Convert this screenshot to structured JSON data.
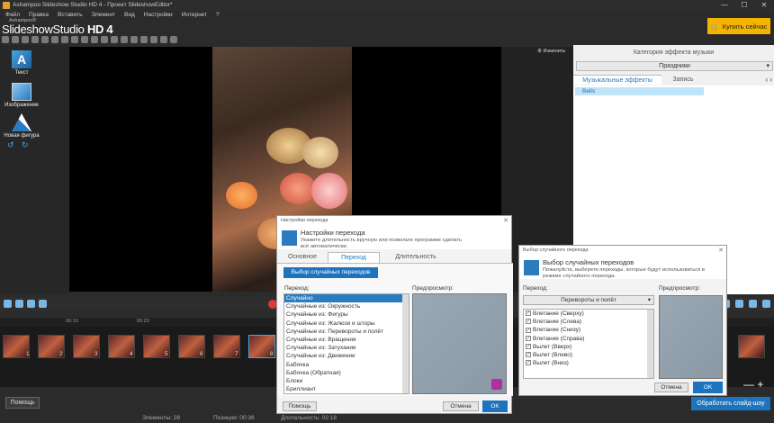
{
  "window": {
    "title": "Ashampoo Slideshow Studio HD 4 - Проект SlideshowEditor*",
    "controls": [
      "—",
      "☐",
      "✕"
    ]
  },
  "menu": [
    "Файл",
    "Правка",
    "Вставить",
    "Элемент",
    "Вид",
    "Настройки",
    "Интернет",
    "?"
  ],
  "buy_button": "Купить сейчас",
  "logo": {
    "small": "Ashampoo®",
    "main": "SlideshowStudio",
    "version": "HD 4"
  },
  "left_panel": {
    "text_label": "Текст",
    "image_label": "Изображение",
    "shape_label": "Новая фигура"
  },
  "preview": {
    "change_label": "Изменить"
  },
  "right_panel": {
    "title": "Категория эффекта музыки",
    "category": "Праздники",
    "tabs": [
      "Музыкальные эффекты",
      "Запись"
    ],
    "items": [
      "Bells"
    ]
  },
  "timeline": {
    "ruler": [
      "00:10",
      "00:20"
    ],
    "clip_numbers": [
      "1",
      "2",
      "3",
      "4",
      "5",
      "6",
      "7",
      "8"
    ],
    "zoom": "— +"
  },
  "bottom": {
    "help": "Помощь",
    "export": "Обработать слайд-шоу"
  },
  "status": {
    "elements": "Элементы: 28",
    "position": "Позиция: 00:36",
    "duration": "Длительность: 02:18"
  },
  "transition_dialog": {
    "window_title": "Настройки перехода",
    "header_title": "Настройки перехода",
    "header_desc": "Укажите длительность вручную или позвольте программе сделать всё автоматически.",
    "tabs": [
      "Основное",
      "Переход",
      "Длительность"
    ],
    "random_button": "Выбор случайных переходов",
    "transition_label": "Переход:",
    "preview_label": "Предпросмотр:",
    "items": [
      "Случайно",
      "Случайные из: Окружность",
      "Случайные из: Фигуры",
      "Случайные из: Жалюзи и шторы",
      "Случайные из: Перевороты и полёт",
      "Случайные из: Вращения",
      "Случайные из: Затухание",
      "Случайные из: Движение",
      "Бабочка",
      "Бабочка (Обратная)",
      "Блоки",
      "Бриллиант"
    ],
    "help": "Помощь",
    "cancel": "Отмена",
    "ok": "OK"
  },
  "random_dialog": {
    "window_title": "Выбор случайного перехода",
    "header_title": "Выбор случайных переходов",
    "header_desc": "Пожалуйста, выберете переходы, которые будут использоваться в режиме случайного перехода.",
    "transition_label": "Переход:",
    "preview_label": "Предпросмотр:",
    "category": "Перевороты и полёт",
    "items": [
      "Влетание (Сверху)",
      "Влетание (Слева)",
      "Влетание (Снизу)",
      "Влетание (Справа)",
      "Вылет (Вверх)",
      "Вылет (Влево)",
      "Вылет (Вниз)"
    ],
    "cancel": "Отмена",
    "ok": "OK"
  }
}
